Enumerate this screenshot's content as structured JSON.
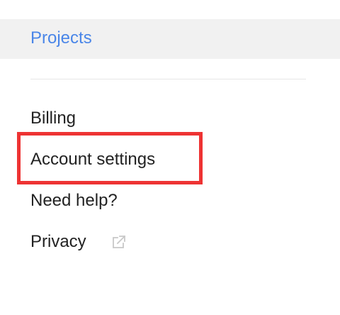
{
  "nav": {
    "active_item": "Projects",
    "items": [
      {
        "label": "Billing"
      },
      {
        "label": "Account settings"
      },
      {
        "label": "Need help?"
      },
      {
        "label": "Privacy",
        "icon": "external-link-icon"
      }
    ]
  },
  "colors": {
    "accent": "#4a86e8",
    "active_background": "#f1f1f1",
    "highlight": "#ee3333",
    "text": "#222222"
  }
}
